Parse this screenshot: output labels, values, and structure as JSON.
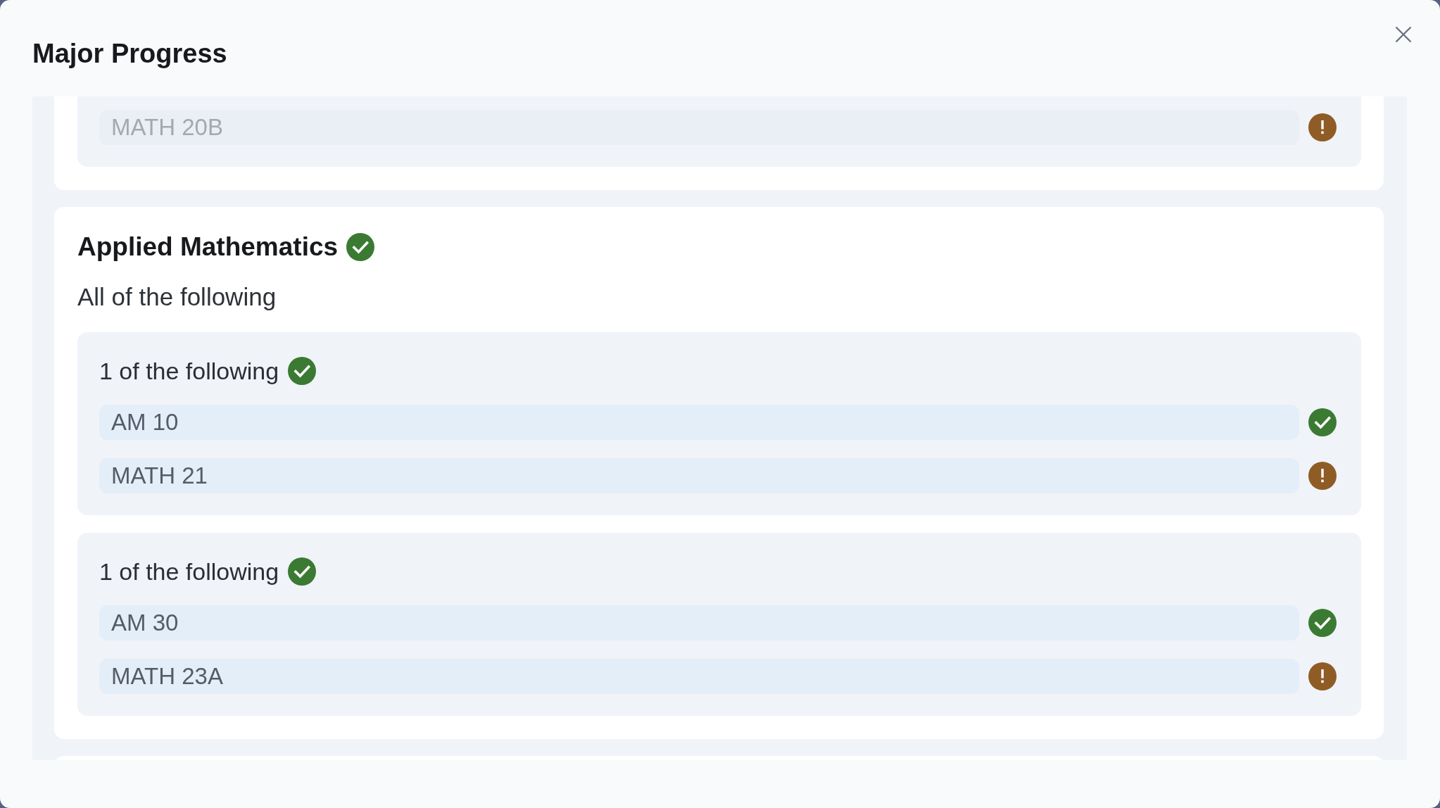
{
  "dialog": {
    "title": "Major Progress"
  },
  "sections": [
    {
      "groups": [
        {
          "courses": [
            {
              "code": "MATH 20B",
              "complete": false,
              "disabled": true
            }
          ]
        }
      ]
    },
    {
      "title": "Applied Mathematics",
      "complete": true,
      "rule": "All of the following",
      "groups": [
        {
          "rule": "1 of the following",
          "complete": true,
          "courses": [
            {
              "code": "AM 10",
              "complete": true,
              "disabled": false
            },
            {
              "code": "MATH 21",
              "complete": false,
              "disabled": false
            }
          ]
        },
        {
          "rule": "1 of the following",
          "complete": true,
          "courses": [
            {
              "code": "AM 30",
              "complete": true,
              "disabled": false
            },
            {
              "code": "MATH 23A",
              "complete": false,
              "disabled": false
            }
          ]
        }
      ]
    }
  ]
}
